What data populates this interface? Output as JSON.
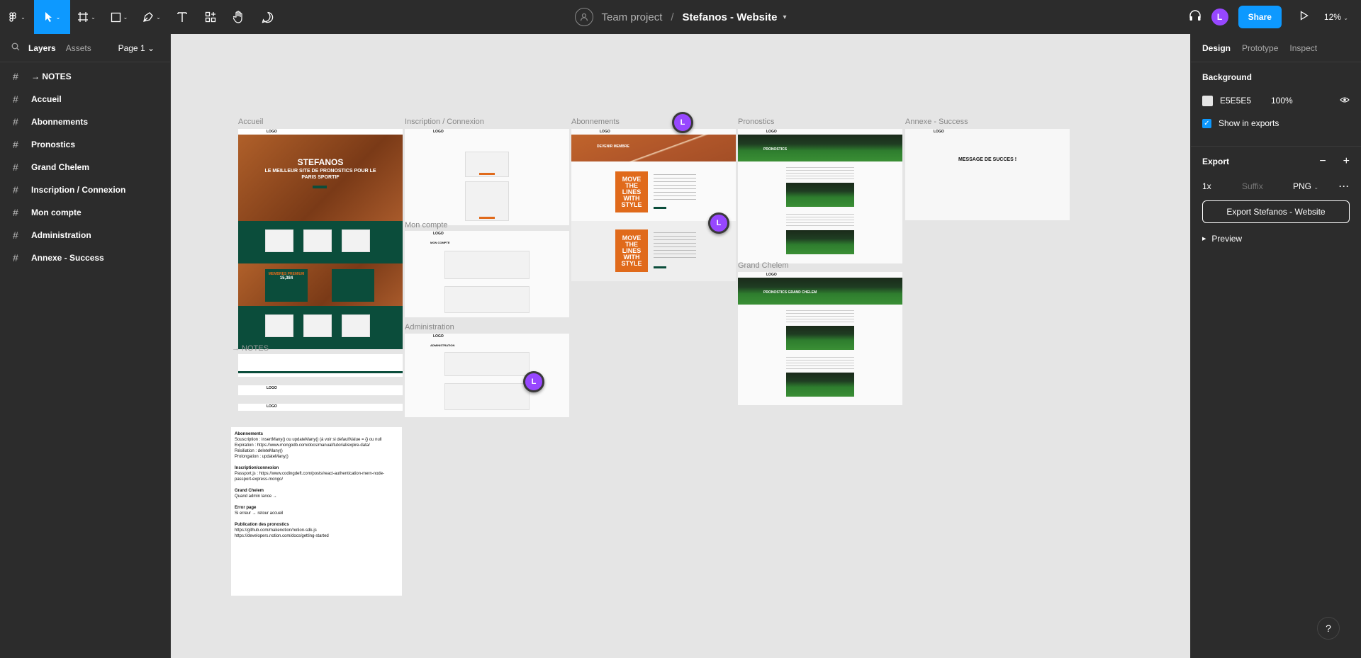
{
  "toolbar": {
    "team_name": "Team project",
    "separator": "/",
    "file_name": "Stefanos - Website",
    "share_label": "Share",
    "zoom": "12%",
    "user_initial": "L",
    "colors": {
      "accent": "#0d99ff",
      "user": "#9747ff"
    },
    "icons": [
      "figma-menu-icon",
      "move-icon",
      "frame-icon",
      "shape-icon",
      "pen-icon",
      "text-icon",
      "resources-icon",
      "hand-icon",
      "comment-icon",
      "headphones-icon",
      "play-icon"
    ]
  },
  "left_panel": {
    "tabs": [
      "Layers",
      "Assets"
    ],
    "page": "Page 1 ⌄",
    "layers": [
      "→ NOTES",
      "Accueil",
      "Abonnements",
      "Pronostics",
      "Grand Chelem",
      "Inscription / Connexion",
      "Mon compte",
      "Administration",
      "Annexe - Success"
    ]
  },
  "right_panel": {
    "tabs": [
      "Design",
      "Prototype",
      "Inspect"
    ],
    "background": {
      "title": "Background",
      "hex": "E5E5E5",
      "opacity": "100%",
      "show_in_exports": "Show in exports"
    },
    "export": {
      "title": "Export",
      "scale": "1x",
      "suffix_placeholder": "Suffix",
      "format": "PNG",
      "button": "Export Stefanos - Website",
      "preview": "Preview"
    }
  },
  "canvas": {
    "frame_labels": {
      "accueil": "Accueil",
      "inscription": "Inscription / Connexion",
      "abonnements": "Abonnements",
      "pronostics": "Pronostics",
      "annexe": "Annexe - Success",
      "mon_compte": "Mon compte",
      "administration": "Administration",
      "grand_chelem": "Grand Chelem",
      "notes": "→ NOTES"
    },
    "mini": {
      "logo": "LOGO",
      "hero_title": "STEFANOS",
      "hero_sub": "LE MEILLEUR SITE DE PRONOSTICS POUR LE PARIS SPORTIF",
      "membres": "MEMBRES PREMIUM",
      "membres_count": "15,384",
      "devenir_membre": "DEVENIR MEMBRE",
      "pronostics": "PRONOSTICS",
      "pronostics_gc": "PRONOSTICS GRAND CHELEM",
      "mon_compte": "MON COMPTE",
      "administration": "ADMINISTRATION",
      "success": "MESSAGE DE SUCCES !",
      "poster": "MOVE THE LINES WITH STYLE"
    },
    "notes": [
      {
        "title": "Abonnements",
        "lines": [
          "Souscription : insertMany() ou updateMany() (à voir si defaultValue = {} ou null",
          "Expiration : https://www.mongodb.com/docs/manual/tutorial/expire-data/",
          "Résiliation : deleteMany()",
          "Prolongation : updateMany()"
        ]
      },
      {
        "title": "Inscription/connexion",
        "lines": [
          "Passport.js : https://www.codingdeft.com/posts/react-authentication-mern-node-passport-express-mongo/"
        ]
      },
      {
        "title": "Grand Chelem",
        "lines": [
          "Quand admin lance →"
        ]
      },
      {
        "title": "Error page",
        "lines": [
          "Si erreur → retour accueil"
        ]
      },
      {
        "title": "Publication des pronostics",
        "lines": [
          "https://github.com/makenotion/notion-sdk-js",
          "https://developers.notion.com/docs/getting-started"
        ]
      }
    ],
    "cursor_label": "L"
  },
  "help": "?"
}
